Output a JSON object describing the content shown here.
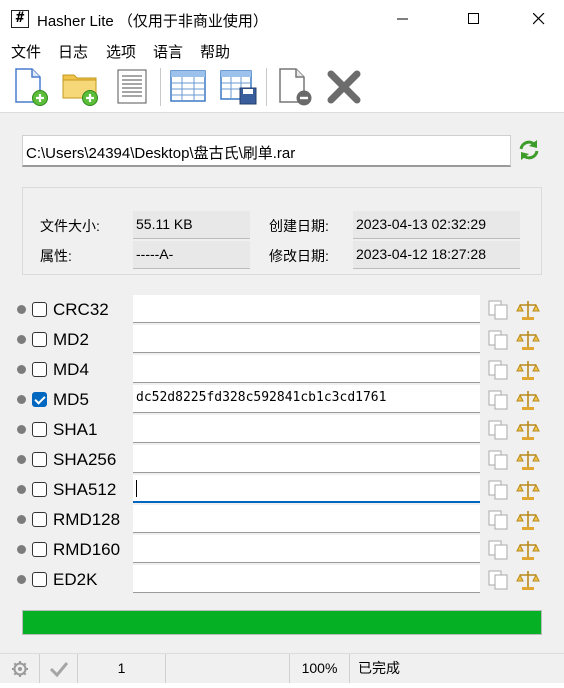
{
  "window": {
    "app_icon_glyph": "#",
    "title": "Hasher Lite  （仅用于非商业使用）",
    "controls": [
      "minimize-icon",
      "maximize-icon",
      "close-icon"
    ]
  },
  "menu": [
    "文件",
    "日志",
    "选项",
    "语言",
    "帮助"
  ],
  "toolbar": {
    "buttons": [
      "new-file-icon",
      "open-folder-icon",
      "document-icon",
      "table-icon",
      "save-table-icon",
      "remove-icon",
      "delete-x-icon"
    ]
  },
  "file": {
    "path": "C:\\Users\\24394\\Desktop\\盘古氏\\刷单.rar",
    "refresh_icon": "refresh-icon"
  },
  "info": {
    "size_label": "文件大小:",
    "size_value": "55.11 KB",
    "attr_label": "属性:",
    "attr_value": "-----A-",
    "created_label": "创建日期:",
    "created_value": "2023-04-13 02:32:29",
    "modified_label": "修改日期:",
    "modified_value": "2023-04-12 18:27:28"
  },
  "hashes": [
    {
      "name": "CRC32",
      "checked": false,
      "value": ""
    },
    {
      "name": "MD2",
      "checked": false,
      "value": ""
    },
    {
      "name": "MD4",
      "checked": false,
      "value": ""
    },
    {
      "name": "MD5",
      "checked": true,
      "value": "dc52d8225fd328c592841cb1c3cd1761"
    },
    {
      "name": "SHA1",
      "checked": false,
      "value": ""
    },
    {
      "name": "SHA256",
      "checked": false,
      "value": ""
    },
    {
      "name": "SHA512",
      "checked": false,
      "value": "",
      "focused": true
    },
    {
      "name": "RMD128",
      "checked": false,
      "value": ""
    },
    {
      "name": "RMD160",
      "checked": false,
      "value": ""
    },
    {
      "name": "ED2K",
      "checked": false,
      "value": ""
    }
  ],
  "progress": {
    "fraction": 1.0,
    "color": "#06b025"
  },
  "status": {
    "settings_icon": "gear-icon",
    "check_icon": "checkmark-icon",
    "count": "1",
    "percent": "100%",
    "state": "已完成"
  }
}
